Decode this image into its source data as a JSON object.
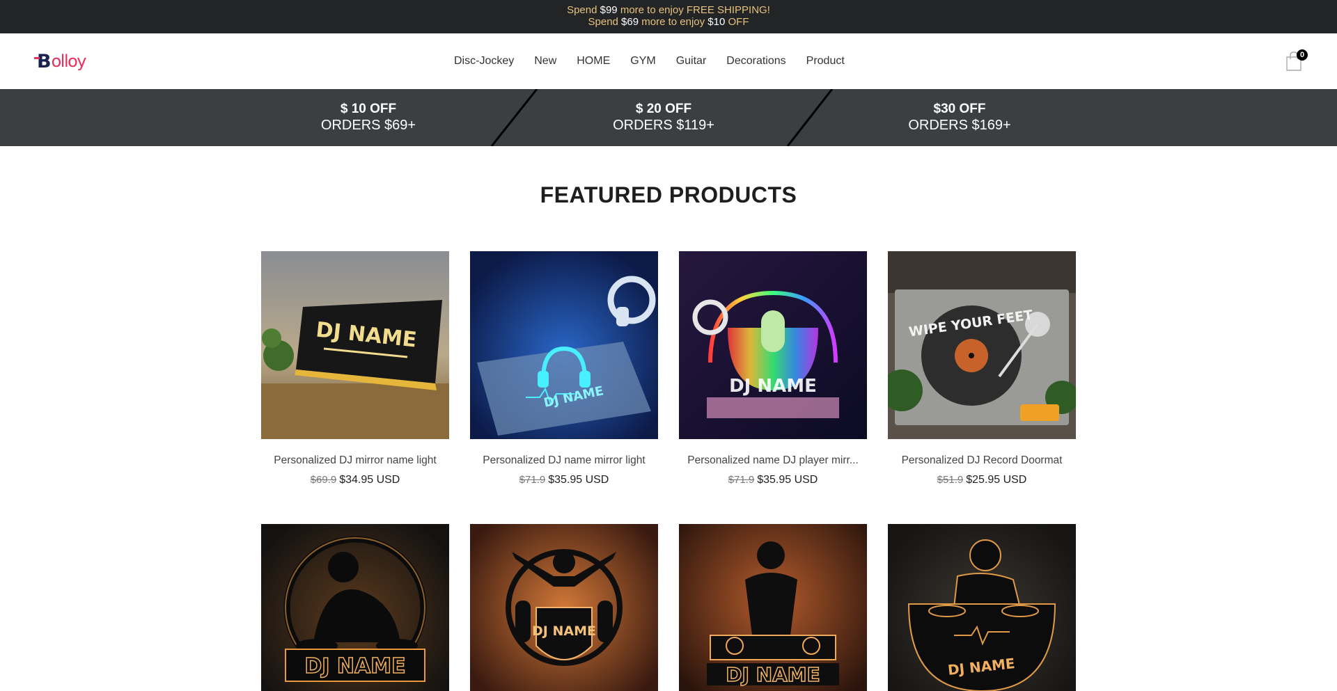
{
  "announcement": {
    "line1": {
      "pre": "Spend ",
      "amount": "$99",
      "post": " more to enjoy FREE SHIPPING!"
    },
    "line2": {
      "pre": "Spend ",
      "amount": "$69",
      "mid": " more to enjoy ",
      "discount": "$10",
      "post": " OFF"
    }
  },
  "header": {
    "logo": {
      "letter": "B",
      "rest": "olloy"
    },
    "nav": [
      "Disc-Jockey",
      "New",
      "HOME",
      "GYM",
      "Guitar",
      "Decorations",
      "Product"
    ],
    "cart_count": "0",
    "cart_icon": "shopping-bag-icon"
  },
  "promo": [
    {
      "line1": "$ 10 OFF",
      "line2": "ORDERS $69+"
    },
    {
      "line1": "$ 20 OFF",
      "line2": "ORDERS $119+"
    },
    {
      "line1": "$30 OFF",
      "line2": "ORDERS $169+"
    }
  ],
  "featured": {
    "title": "FEATURED PRODUCTS",
    "products": [
      {
        "title": "Personalized DJ mirror name light",
        "old_price": "$69.9",
        "price": "$34.95 USD",
        "image_text": "DJ NAME"
      },
      {
        "title": "Personalized DJ name mirror light",
        "old_price": "$71.9",
        "price": "$35.95 USD",
        "image_text": "DJ NAME"
      },
      {
        "title": "Personalized name DJ player mirr...",
        "old_price": "$71.9",
        "price": "$35.95 USD",
        "image_text": "DJ NAME"
      },
      {
        "title": "Personalized DJ Record Doormat",
        "old_price": "$51.9",
        "price": "$25.95 USD",
        "image_text": "WIPE YOUR FEET"
      },
      {
        "image_text": "DJ NAME"
      },
      {
        "image_text": "DJ NAME"
      },
      {
        "image_text": "DJ NAME"
      },
      {
        "image_text": "DJ NAME"
      }
    ]
  },
  "colors": {
    "announcement_bg": "#222426",
    "announcement_text": "#e7c27c",
    "promo_bg": "#3b3f42",
    "logo_accent": "#e5305b",
    "logo_dark": "#1b2250"
  }
}
